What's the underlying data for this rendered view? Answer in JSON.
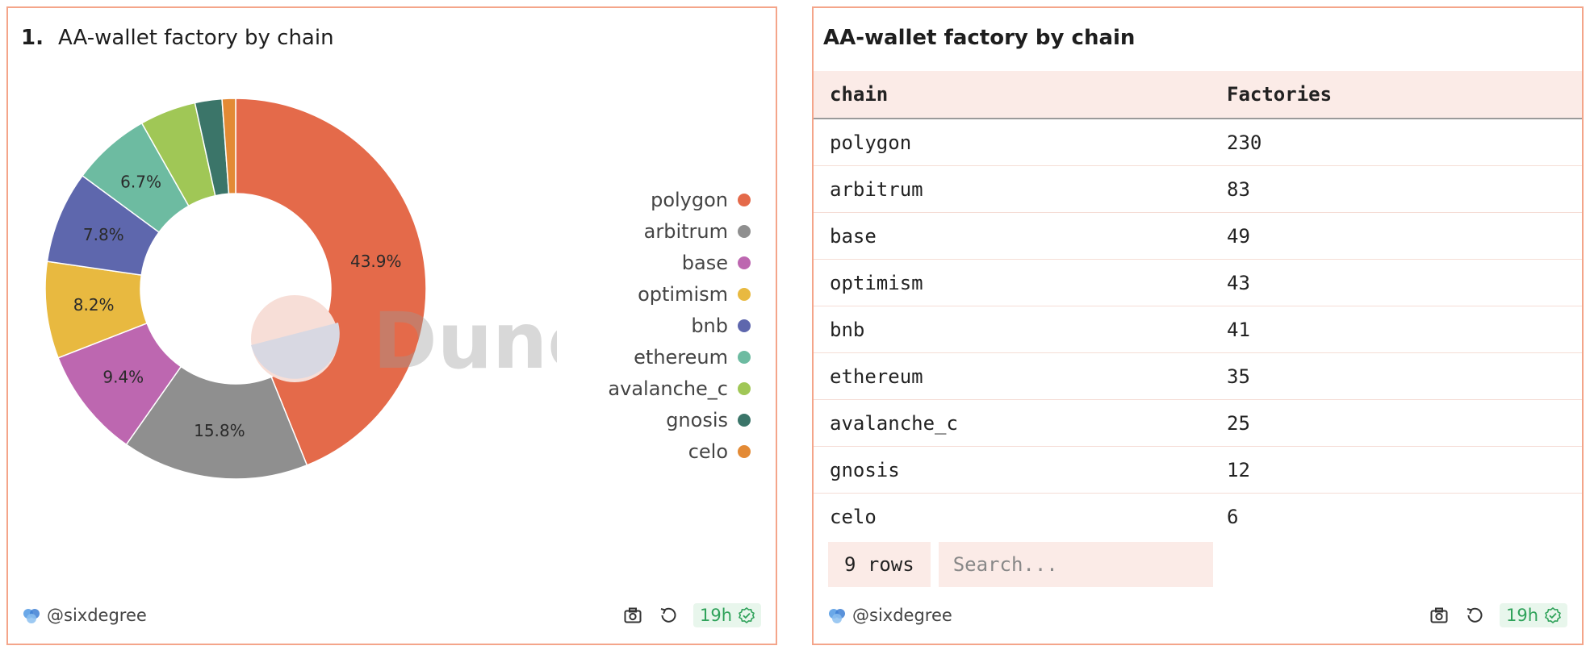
{
  "left_panel": {
    "number": "1.",
    "title": "AA-wallet factory by chain",
    "watermark": "Dune",
    "author": "@sixdegree",
    "age": "19h"
  },
  "right_panel": {
    "title": "AA-wallet factory by chain",
    "author": "@sixdegree",
    "age": "19h",
    "rows_label": "9 rows",
    "search_placeholder": "Search...",
    "columns": [
      "chain",
      "Factories"
    ],
    "rows": [
      {
        "chain": "polygon",
        "factories": "230"
      },
      {
        "chain": "arbitrum",
        "factories": "83"
      },
      {
        "chain": "base",
        "factories": "49"
      },
      {
        "chain": "optimism",
        "factories": "43"
      },
      {
        "chain": "bnb",
        "factories": "41"
      },
      {
        "chain": "ethereum",
        "factories": "35"
      },
      {
        "chain": "avalanche_c",
        "factories": "25"
      },
      {
        "chain": "gnosis",
        "factories": "12"
      },
      {
        "chain": "celo",
        "factories": "6"
      }
    ]
  },
  "icons": {
    "camera": "camera-icon",
    "refresh": "refresh-icon",
    "check": "check-circle-icon",
    "author_logo": "user-logo-icon"
  },
  "chart_data": {
    "type": "pie",
    "title": "AA-wallet factory by chain",
    "donut": true,
    "legend_position": "right",
    "categories": [
      "polygon",
      "arbitrum",
      "base",
      "optimism",
      "bnb",
      "ethereum",
      "avalanche_c",
      "gnosis",
      "celo"
    ],
    "values": [
      230,
      83,
      49,
      43,
      41,
      35,
      25,
      12,
      6
    ],
    "labels": [
      "43.9%",
      "15.8%",
      "9.4%",
      "8.2%",
      "7.8%",
      "6.7%",
      "",
      "",
      ""
    ],
    "colors": [
      "#e46a4a",
      "#8f8f8f",
      "#bd67b0",
      "#e8b940",
      "#5e67ad",
      "#6dbba1",
      "#a0c756",
      "#3b7569",
      "#e38a35"
    ]
  }
}
